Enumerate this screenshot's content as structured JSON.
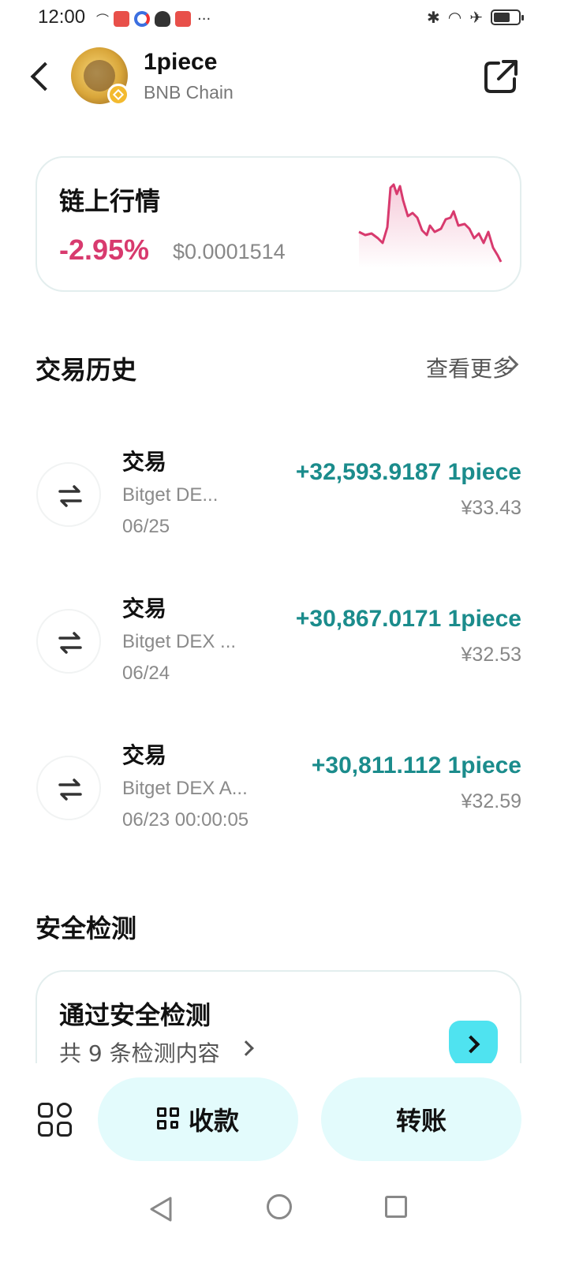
{
  "status_bar": {
    "time": "12:00",
    "dots": "···"
  },
  "header": {
    "token_name": "1piece",
    "chain_name": "BNB Chain",
    "icons": [
      "back-icon",
      "share-icon"
    ]
  },
  "market": {
    "title": "链上行情",
    "change": "-2.95%",
    "price": "$0.0001514",
    "change_color": "#d83a6e"
  },
  "history": {
    "title": "交易历史",
    "view_more": "查看更多",
    "items": [
      {
        "type": "交易",
        "source": "Bitget DE...",
        "date": "06/25",
        "amount": "+32,593.9187 1piece",
        "fiat": "¥33.43"
      },
      {
        "type": "交易",
        "source": "Bitget DEX ...",
        "date": "06/24",
        "amount": "+30,867.0171 1piece",
        "fiat": "¥32.53"
      },
      {
        "type": "交易",
        "source": "Bitget DEX A...",
        "date": "06/23 00:00:05",
        "amount": "+30,811.112 1piece",
        "fiat": "¥32.59"
      }
    ],
    "amount_color": "#1b8c8c"
  },
  "security": {
    "section_title": "安全检测",
    "card_title": "通过安全检测",
    "card_subtitle": "共 9 条检测内容"
  },
  "actions": {
    "receive": "收款",
    "transfer": "转账"
  }
}
